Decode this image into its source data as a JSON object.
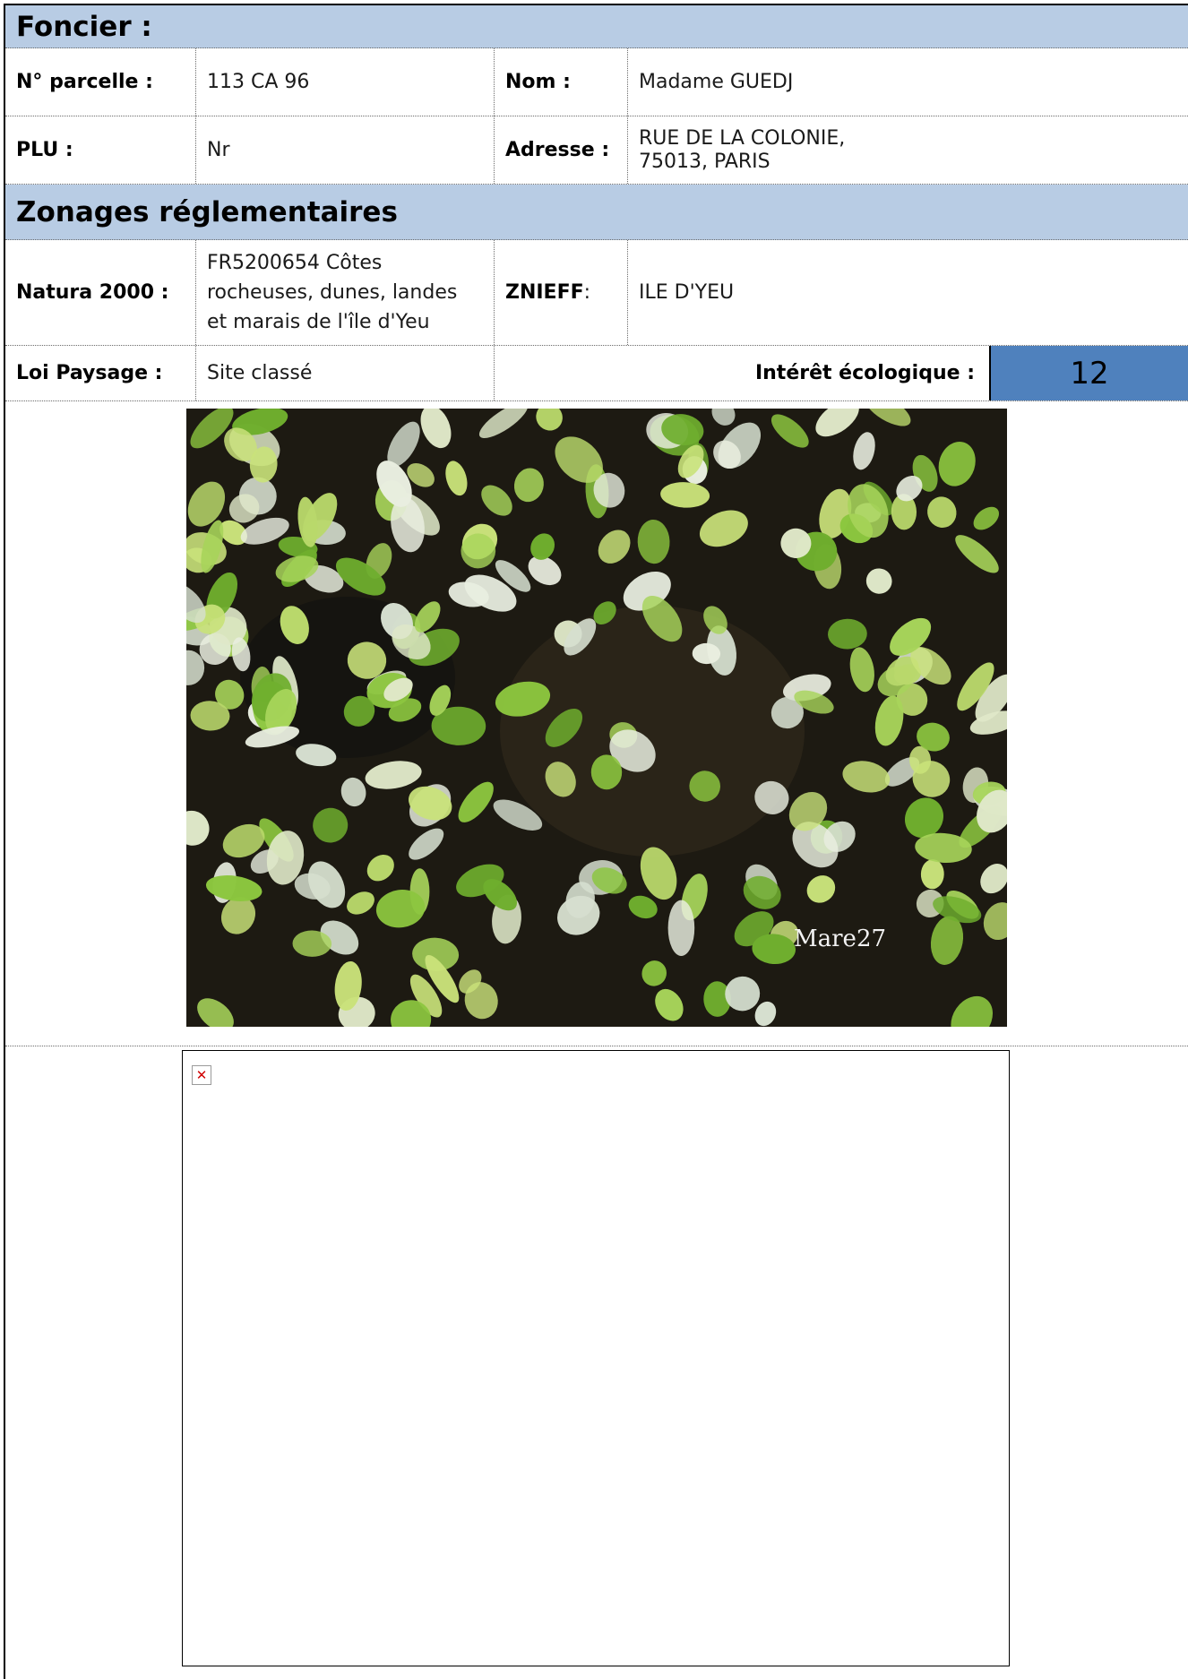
{
  "foncier": {
    "title": "Foncier :",
    "parcelle_label": "N° parcelle :",
    "parcelle_value": "113 CA 96",
    "nom_label": "Nom :",
    "nom_value": "Madame GUEDJ",
    "plu_label": "PLU :",
    "plu_value": "Nr",
    "adresse_label": "Adresse :",
    "adresse_line1": "RUE DE LA COLONIE,",
    "adresse_line2": "75013, PARIS"
  },
  "zonages": {
    "title": "Zonages réglementaires",
    "natura_label": "Natura 2000 :",
    "natura_line1": "FR5200654 Côtes",
    "natura_line2": "rocheuses, dunes, landes",
    "natura_line3": "et marais de l'île d'Yeu",
    "znieff_label": "ZNIEFF",
    "znieff_colon": " :",
    "znieff_value": "ILE D'YEU",
    "paysage_label": "Loi Paysage :",
    "paysage_value": "Site classé",
    "interet_label": "Intérêt écologique :",
    "interet_value": "12"
  },
  "photo": {
    "watermark": "Mare27"
  },
  "broken_image": {
    "icon": "broken-image-icon"
  },
  "colors": {
    "section_bg": "#b8cce4",
    "score_bg": "#4f81bd"
  }
}
